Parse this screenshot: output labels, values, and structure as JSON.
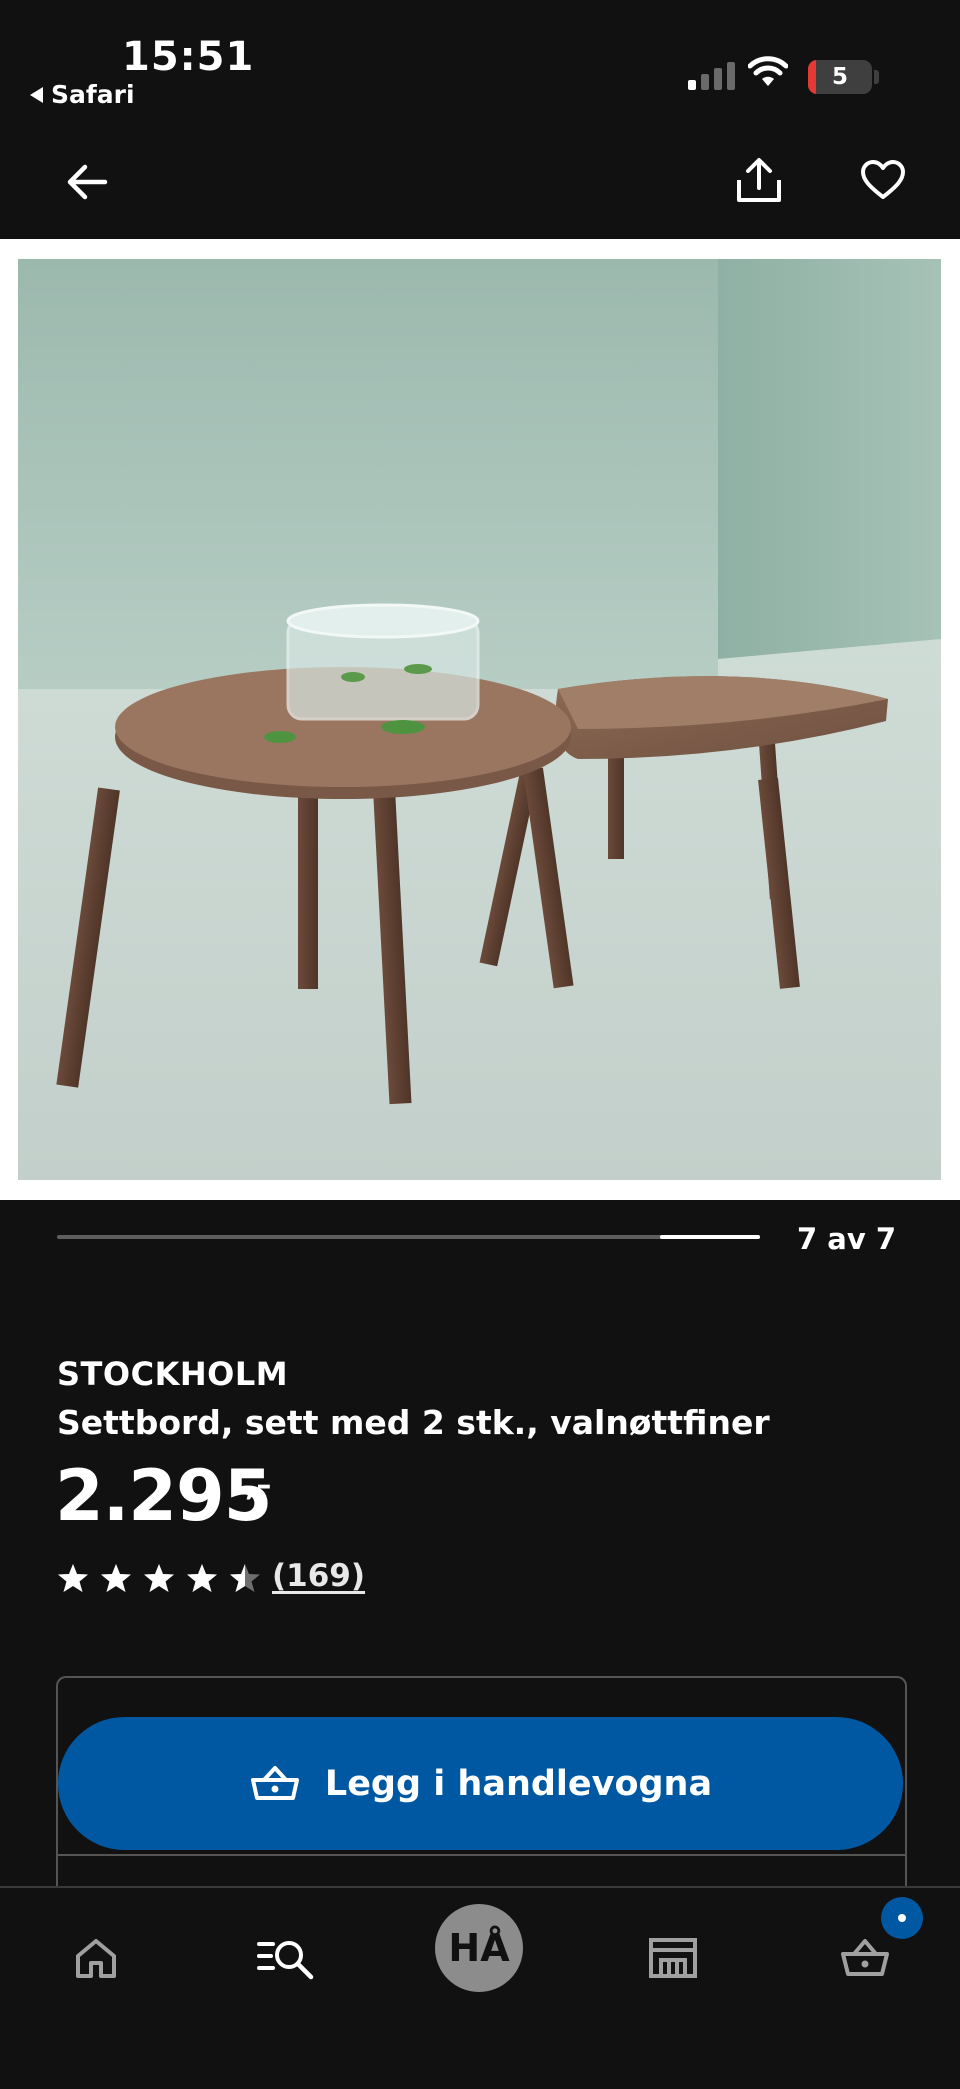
{
  "status_bar": {
    "time": "15:51",
    "back_app": "Safari",
    "battery_level": "5"
  },
  "gallery": {
    "counter": "7 av 7",
    "current_index": 7,
    "total": 7
  },
  "product": {
    "brand": "STOCKHOLM",
    "description": "Settbord, sett med 2 stk., valnøttfiner",
    "price": "2.295",
    "price_suffix": ",–",
    "rating": 4.5,
    "rating_max": 5,
    "review_count": "(169)"
  },
  "actions": {
    "add_to_cart": "Legg i handlevogna"
  },
  "tabbar": {
    "home": "home-icon",
    "search": "search-list-icon",
    "center_label": "HÅ",
    "store": "store-icon",
    "cart": "cart-icon"
  },
  "colors": {
    "background": "#111111",
    "accent_blue": "#0058a3",
    "text": "#ffffff"
  }
}
